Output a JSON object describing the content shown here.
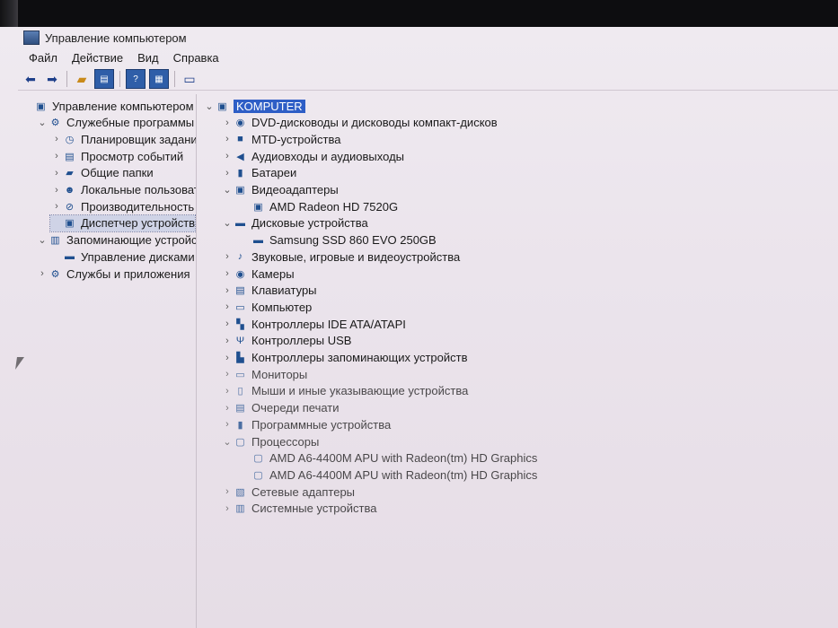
{
  "window": {
    "title": "Управление компьютером"
  },
  "menu": [
    "Файл",
    "Действие",
    "Вид",
    "Справка"
  ],
  "toolbar_icons": [
    "back-arrow-icon",
    "forward-arrow-icon",
    "folder-up-icon",
    "show-hide-tree-icon",
    "help-icon",
    "properties-icon",
    "monitor-icon"
  ],
  "left_tree": [
    {
      "label": "Управление компьютером (л",
      "indent": 0,
      "chevron": "",
      "icon": "computer-management-icon"
    },
    {
      "label": "Служебные программы",
      "indent": 1,
      "chevron": "v",
      "icon": "tools-icon"
    },
    {
      "label": "Планировщик заданий",
      "indent": 2,
      "chevron": ">",
      "icon": "clock-icon"
    },
    {
      "label": "Просмотр событий",
      "indent": 2,
      "chevron": ">",
      "icon": "event-viewer-icon"
    },
    {
      "label": "Общие папки",
      "indent": 2,
      "chevron": ">",
      "icon": "shared-folder-icon"
    },
    {
      "label": "Локальные пользовате",
      "indent": 2,
      "chevron": ">",
      "icon": "users-icon"
    },
    {
      "label": "Производительность",
      "indent": 2,
      "chevron": ">",
      "icon": "performance-icon"
    },
    {
      "label": "Диспетчер устройств",
      "indent": 2,
      "chevron": "",
      "icon": "device-manager-icon",
      "selected": true
    },
    {
      "label": "Запоминающие устройст",
      "indent": 1,
      "chevron": "v",
      "icon": "storage-icon"
    },
    {
      "label": "Управление дисками",
      "indent": 2,
      "chevron": "",
      "icon": "disk-management-icon"
    },
    {
      "label": "Службы и приложения",
      "indent": 1,
      "chevron": ">",
      "icon": "services-icon"
    }
  ],
  "device_tree": [
    {
      "label": "KOMPUTER",
      "indent": 0,
      "chevron": "v",
      "icon": "computer-icon",
      "root": true
    },
    {
      "label": "DVD-дисководы и дисководы компакт-дисков",
      "indent": 1,
      "chevron": ">",
      "icon": "dvd-drive-icon"
    },
    {
      "label": "MTD-устройства",
      "indent": 1,
      "chevron": ">",
      "icon": "mtd-device-icon"
    },
    {
      "label": "Аудиовходы и аудиовыходы",
      "indent": 1,
      "chevron": ">",
      "icon": "speaker-icon"
    },
    {
      "label": "Батареи",
      "indent": 1,
      "chevron": ">",
      "icon": "battery-icon"
    },
    {
      "label": "Видеоадаптеры",
      "indent": 1,
      "chevron": "v",
      "icon": "display-adapter-icon"
    },
    {
      "label": "AMD Radeon HD 7520G",
      "indent": 2,
      "chevron": "",
      "icon": "display-adapter-icon"
    },
    {
      "label": "Дисковые устройства",
      "indent": 1,
      "chevron": "v",
      "icon": "disk-drive-icon"
    },
    {
      "label": "Samsung SSD 860 EVO 250GB",
      "indent": 2,
      "chevron": "",
      "icon": "disk-drive-icon"
    },
    {
      "label": "Звуковые, игровые и видеоустройства",
      "indent": 1,
      "chevron": ">",
      "icon": "sound-icon"
    },
    {
      "label": "Камеры",
      "indent": 1,
      "chevron": ">",
      "icon": "camera-icon"
    },
    {
      "label": "Клавиатуры",
      "indent": 1,
      "chevron": ">",
      "icon": "keyboard-icon"
    },
    {
      "label": "Компьютер",
      "indent": 1,
      "chevron": ">",
      "icon": "monitor-icon"
    },
    {
      "label": "Контроллеры IDE ATA/ATAPI",
      "indent": 1,
      "chevron": ">",
      "icon": "ide-controller-icon"
    },
    {
      "label": "Контроллеры USB",
      "indent": 1,
      "chevron": ">",
      "icon": "usb-icon"
    },
    {
      "label": "Контроллеры запоминающих устройств",
      "indent": 1,
      "chevron": ">",
      "icon": "storage-controller-icon"
    },
    {
      "label": "Мониторы",
      "indent": 1,
      "chevron": ">",
      "icon": "monitor-icon"
    },
    {
      "label": "Мыши и иные указывающие устройства",
      "indent": 1,
      "chevron": ">",
      "icon": "mouse-icon"
    },
    {
      "label": "Очереди печати",
      "indent": 1,
      "chevron": ">",
      "icon": "printer-icon"
    },
    {
      "label": "Программные устройства",
      "indent": 1,
      "chevron": ">",
      "icon": "software-device-icon"
    },
    {
      "label": "Процессоры",
      "indent": 1,
      "chevron": "v",
      "icon": "processor-icon"
    },
    {
      "label": "AMD A6-4400M APU with Radeon(tm) HD Graphics",
      "indent": 2,
      "chevron": "",
      "icon": "processor-icon"
    },
    {
      "label": "AMD A6-4400M APU with Radeon(tm) HD Graphics",
      "indent": 2,
      "chevron": "",
      "icon": "processor-icon"
    },
    {
      "label": "Сетевые адаптеры",
      "indent": 1,
      "chevron": ">",
      "icon": "network-adapter-icon"
    },
    {
      "label": "Системные устройства",
      "indent": 1,
      "chevron": ">",
      "icon": "system-device-icon"
    }
  ],
  "colors": {
    "selection": "#2e5ec6",
    "accent": "#1f4f8f"
  }
}
